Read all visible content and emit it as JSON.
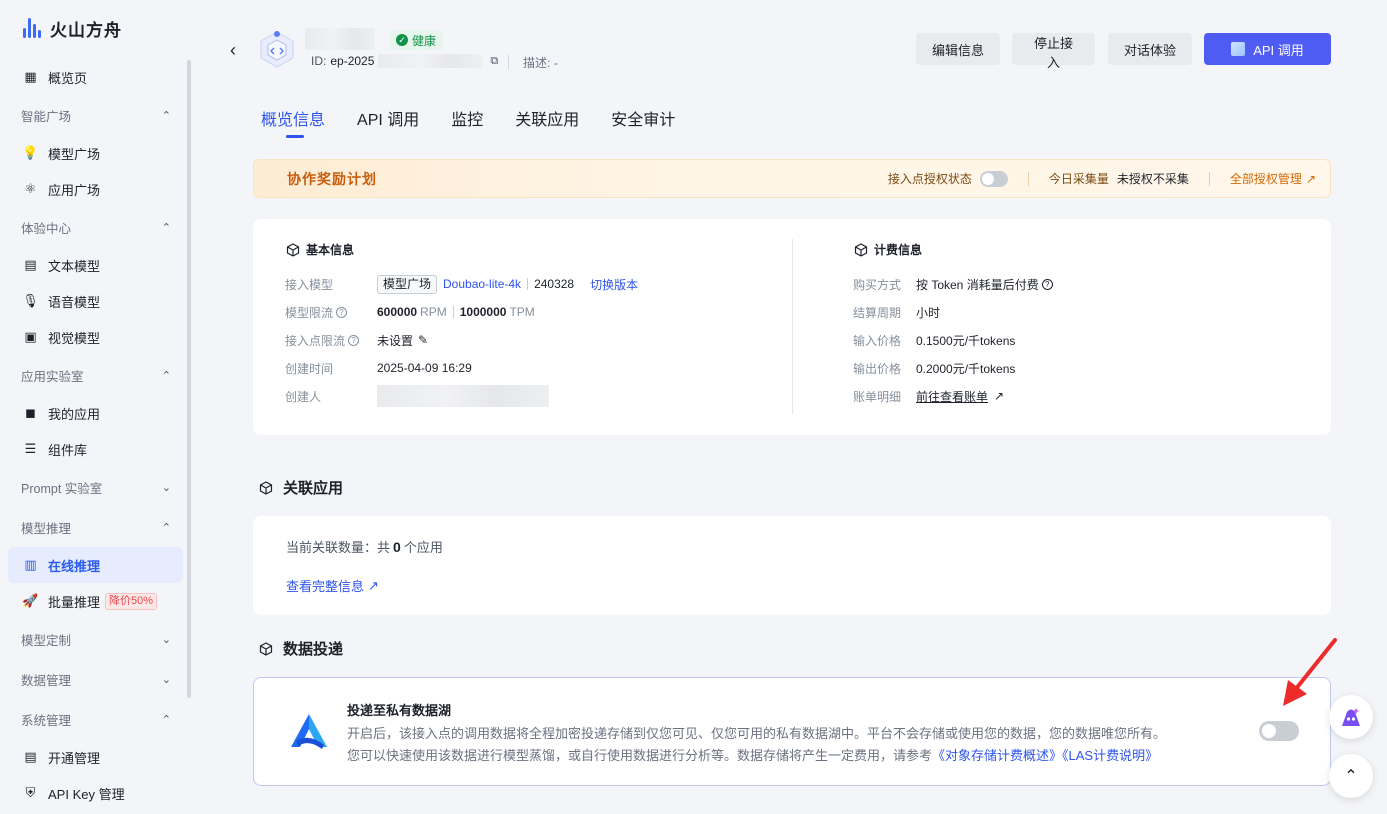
{
  "app": {
    "brand": "火山方舟"
  },
  "sidebar": {
    "items": [
      {
        "type": "item",
        "label": "概览页",
        "icon": "dashboard-icon"
      },
      {
        "type": "group",
        "label": "智能广场",
        "chevron": "^"
      },
      {
        "type": "item",
        "label": "模型广场",
        "icon": "bulb-icon"
      },
      {
        "type": "item",
        "label": "应用广场",
        "icon": "atom-icon"
      },
      {
        "type": "group",
        "label": "体验中心",
        "chevron": "^"
      },
      {
        "type": "item",
        "label": "文本模型",
        "icon": "text-model-icon"
      },
      {
        "type": "item",
        "label": "语音模型",
        "icon": "microphone-icon"
      },
      {
        "type": "item",
        "label": "视觉模型",
        "icon": "vision-icon"
      },
      {
        "type": "group",
        "label": "应用实验室",
        "chevron": "^"
      },
      {
        "type": "item",
        "label": "我的应用",
        "icon": "apps-icon"
      },
      {
        "type": "item",
        "label": "组件库",
        "icon": "component-icon"
      },
      {
        "type": "group",
        "label": "Prompt 实验室",
        "chevron": "v"
      },
      {
        "type": "group",
        "label": "模型推理",
        "chevron": "^"
      },
      {
        "type": "item",
        "label": "在线推理",
        "icon": "chart-icon",
        "active": true
      },
      {
        "type": "item",
        "label": "批量推理",
        "icon": "rocket-icon",
        "badge": "降价50%"
      },
      {
        "type": "group",
        "label": "模型定制",
        "chevron": "v"
      },
      {
        "type": "group",
        "label": "数据管理",
        "chevron": "v"
      },
      {
        "type": "group",
        "label": "系统管理",
        "chevron": "^"
      },
      {
        "type": "item",
        "label": "开通管理",
        "icon": "doc-icon"
      },
      {
        "type": "item",
        "label": "API Key 管理",
        "icon": "shield-icon"
      }
    ]
  },
  "header": {
    "status": "健康",
    "id_label": "ID:",
    "id_value": "ep-2025",
    "desc_label": "描述:",
    "desc_value": "-",
    "buttons": {
      "edit": "编辑信息",
      "stop": "停止接入",
      "chat": "对话体验",
      "api": "API 调用"
    }
  },
  "tabs": [
    "概览信息",
    "API 调用",
    "监控",
    "关联应用",
    "安全审计"
  ],
  "reward": {
    "title": "协作奖励计划",
    "auth_status_label": "接入点授权状态",
    "today_label": "今日采集量",
    "today_value": "未授权不采集",
    "manage_link": "全部授权管理"
  },
  "basic_info": {
    "title": "基本信息",
    "model_label": "接入模型",
    "model_tag": "模型广场",
    "model_name": "Doubao-lite-4k",
    "model_version": "240328",
    "switch_version": "切换版本",
    "limit_label": "模型限流",
    "rpm_value": "600000",
    "rpm_unit": "RPM",
    "tpm_value": "1000000",
    "tpm_unit": "TPM",
    "endpoint_limit_label": "接入点限流",
    "endpoint_limit_value": "未设置",
    "created_label": "创建时间",
    "created_value": "2025-04-09 16:29",
    "creator_label": "创建人"
  },
  "billing": {
    "title": "计费信息",
    "method_label": "购买方式",
    "method_value": "按 Token 消耗量后付费",
    "cycle_label": "结算周期",
    "cycle_value": "小时",
    "input_label": "输入价格",
    "input_value": "0.1500元/千tokens",
    "output_label": "输出价格",
    "output_value": "0.2000元/千tokens",
    "bill_label": "账单明细",
    "bill_link": "前往查看账单"
  },
  "related_apps": {
    "title": "关联应用",
    "count_prefix": "当前关联数量：共",
    "count": "0",
    "count_suffix": "个应用",
    "view_link": "查看完整信息"
  },
  "data_delivery": {
    "title": "数据投递",
    "card_title": "投递至私有数据湖",
    "desc_line1": "开启后，该接入点的调用数据将全程加密投递存储到仅您可见、仅您可用的私有数据湖中。平台不会存储或使用您的数据，您的数据唯您所有。",
    "desc_line2": "您可以快速使用该数据进行模型蒸馏，或自行使用数据进行分析等。数据存储将产生一定费用，请参考",
    "link1": "《对象存储计费概述》",
    "link2": "《LAS计费说明》"
  },
  "colors": {
    "accent": "#2f54eb",
    "api_button": "#4e5cf4",
    "health": "#14924a",
    "reward": "#c75d0c"
  }
}
